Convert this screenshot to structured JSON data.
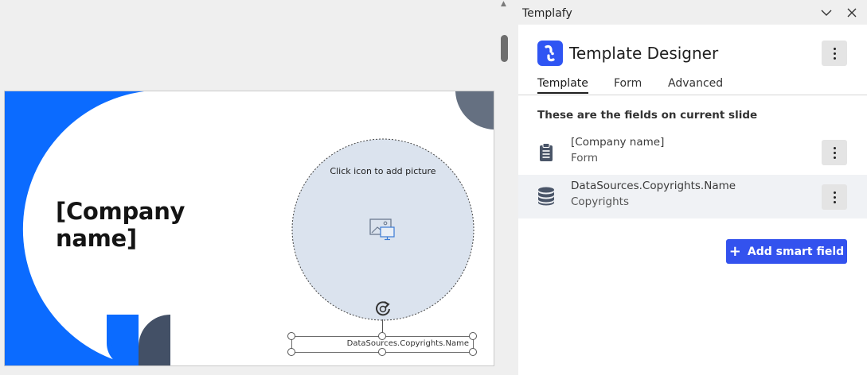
{
  "slide": {
    "company_title_line1": "[Company",
    "company_title_line2": "name]",
    "picture_hint": "Click icon to add picture",
    "textbox_text": "DataSources.Copyrights.Name"
  },
  "pane": {
    "title": "Templafy",
    "designer_title": "Template Designer",
    "tabs": [
      {
        "label": "Template",
        "active": true
      },
      {
        "label": "Form",
        "active": false
      },
      {
        "label": "Advanced",
        "active": false
      }
    ],
    "section_heading": "These are the fields on current slide",
    "fields": [
      {
        "name": "[Company name]",
        "source": "Form",
        "icon": "clipboard-icon"
      },
      {
        "name": "DataSources.Copyrights.Name",
        "source": "Copyrights",
        "icon": "database-icon"
      }
    ],
    "add_button_label": "Add smart field"
  },
  "colors": {
    "brand_blue": "#0b6bff",
    "accent_button": "#3352ee",
    "dark_shape": "#4a5568",
    "picture_placeholder": "#dbe3ee"
  }
}
